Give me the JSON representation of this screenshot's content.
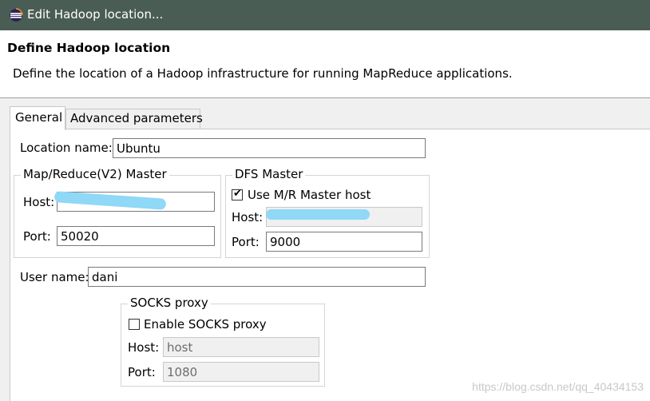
{
  "window": {
    "title": "Edit Hadoop location..."
  },
  "header": {
    "title": "Define Hadoop location",
    "description": "Define the location of a Hadoop infrastructure for running MapReduce applications."
  },
  "tabs": [
    {
      "label": "General",
      "active": true
    },
    {
      "label": "Advanced parameters",
      "active": false
    }
  ],
  "general": {
    "location_name_label": "Location name:",
    "location_name_value": "Ubuntu",
    "mr_master": {
      "legend": "Map/Reduce(V2) Master",
      "host_label": "Host:",
      "host_value": "",
      "port_label": "Port:",
      "port_value": "50020"
    },
    "dfs_master": {
      "legend": "DFS Master",
      "use_mr_label": "Use M/R Master host",
      "use_mr_checked": true,
      "host_label": "Host:",
      "host_value": "",
      "port_label": "Port:",
      "port_value": "9000"
    },
    "user_name_label": "User name:",
    "user_name_value": "dani",
    "socks": {
      "legend": "SOCKS proxy",
      "enable_label": "Enable SOCKS proxy",
      "enable_checked": false,
      "host_label": "Host:",
      "host_value": "host",
      "port_label": "Port:",
      "port_value": "1080"
    }
  },
  "watermark": "https://blog.csdn.net/qq_40434153",
  "colors": {
    "titlebar": "#4a5d55",
    "content_bg": "#f0f0f0",
    "redaction": "#8fd8f6"
  }
}
